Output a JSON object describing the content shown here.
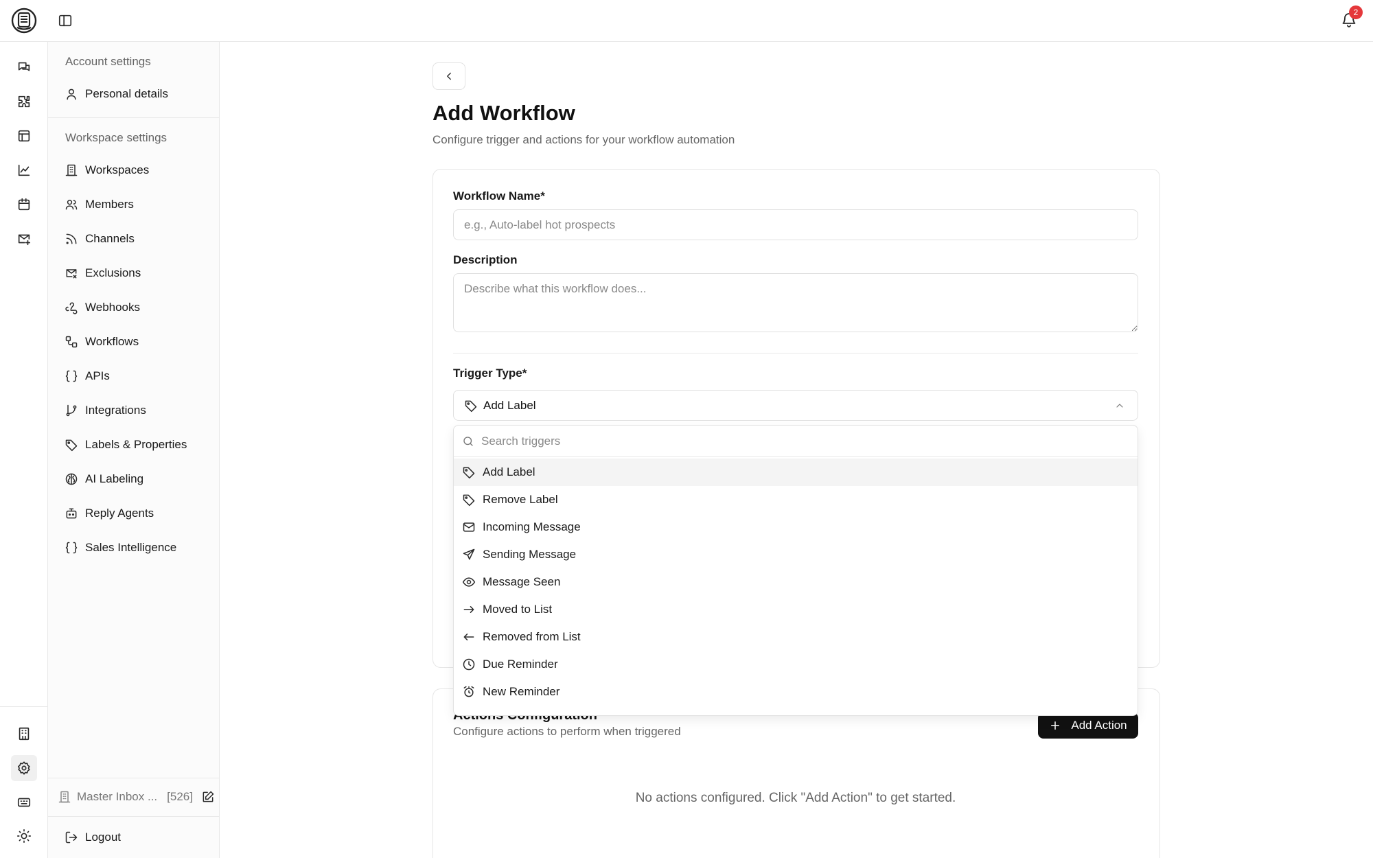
{
  "topbar": {
    "notification_count": "2"
  },
  "rail": {
    "items": [
      {
        "icon": "chat-icon"
      },
      {
        "icon": "puzzle-icon"
      },
      {
        "icon": "table-icon"
      },
      {
        "icon": "chart-icon"
      },
      {
        "icon": "calendar-icon"
      },
      {
        "icon": "mail-plus-icon"
      }
    ],
    "bottom_items": [
      {
        "icon": "building-icon"
      },
      {
        "icon": "gear-icon",
        "active": true
      },
      {
        "icon": "keyboard-icon"
      },
      {
        "icon": "sun-icon"
      }
    ]
  },
  "sidebar": {
    "account_section": "Account settings",
    "account_items": [
      {
        "label": "Personal details",
        "icon": "user-icon"
      }
    ],
    "workspace_section": "Workspace settings",
    "workspace_items": [
      {
        "label": "Workspaces",
        "icon": "building-icon"
      },
      {
        "label": "Members",
        "icon": "users-icon"
      },
      {
        "label": "Channels",
        "icon": "rss-icon"
      },
      {
        "label": "Exclusions",
        "icon": "mail-x-icon"
      },
      {
        "label": "Webhooks",
        "icon": "webhook-icon"
      },
      {
        "label": "Workflows",
        "icon": "workflow-icon"
      },
      {
        "label": "APIs",
        "icon": "braces-icon"
      },
      {
        "label": "Integrations",
        "icon": "git-branch-icon"
      },
      {
        "label": "Labels & Properties",
        "icon": "tag-icon"
      },
      {
        "label": "AI Labeling",
        "icon": "brain-icon"
      },
      {
        "label": "Reply Agents",
        "icon": "bot-icon"
      },
      {
        "label": "Sales Intelligence",
        "icon": "braces-icon"
      }
    ],
    "inbox_name": "Master Inbox ...",
    "inbox_count": "[526]",
    "logout_label": "Logout"
  },
  "main": {
    "title": "Add Workflow",
    "subtitle": "Configure trigger and actions for your workflow automation",
    "workflow_name_label": "Workflow Name*",
    "workflow_name_placeholder": "e.g., Auto-label hot prospects",
    "workflow_name_value": "",
    "description_label": "Description",
    "description_placeholder": "Describe what this workflow does...",
    "description_value": "",
    "trigger_label": "Trigger Type*",
    "trigger_selected": "Add Label",
    "trigger_search_placeholder": "Search triggers",
    "trigger_options": [
      {
        "label": "Add Label",
        "icon": "tag-icon",
        "highlighted": true
      },
      {
        "label": "Remove Label",
        "icon": "tag-icon"
      },
      {
        "label": "Incoming Message",
        "icon": "mail-icon"
      },
      {
        "label": "Sending Message",
        "icon": "send-icon"
      },
      {
        "label": "Message Seen",
        "icon": "eye-icon"
      },
      {
        "label": "Moved to List",
        "icon": "arrow-right-icon"
      },
      {
        "label": "Removed from List",
        "icon": "arrow-left-icon"
      },
      {
        "label": "Due Reminder",
        "icon": "clock-icon"
      },
      {
        "label": "New Reminder",
        "icon": "alarm-icon"
      }
    ],
    "actions_title": "Actions Configuration",
    "actions_subtitle": "Configure actions to perform when triggered",
    "add_action_label": "Add Action",
    "empty_actions_message": "No actions configured. Click \"Add Action\" to get started."
  }
}
